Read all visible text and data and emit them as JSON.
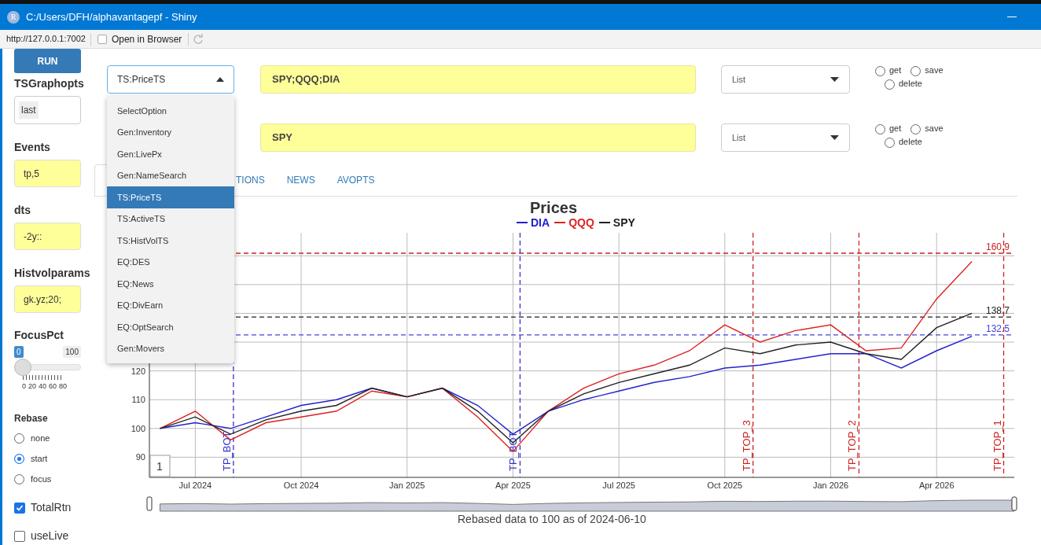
{
  "window": {
    "title": "C:/Users/DFH/alphavantagepf - Shiny",
    "app_icon": "R"
  },
  "address_bar": {
    "url": "http://127.0.0.1:7002",
    "open_in_browser": "Open in Browser"
  },
  "sidebar": {
    "run_button": "RUN",
    "fields": [
      {
        "label": "TSGraphopts",
        "value": "last",
        "kind": "chip"
      },
      {
        "label": "Events",
        "value": "tp,5",
        "kind": "yellow"
      },
      {
        "label": "dts",
        "value": "-2y::",
        "kind": "yellow"
      },
      {
        "label": "Histvolparams",
        "value": "gk.yz;20;",
        "kind": "yellow"
      }
    ],
    "focus": {
      "label": "FocusPct",
      "min_label": "0",
      "max_label": "100",
      "level": 0,
      "tick_labels": [
        "0",
        "20",
        "40",
        "60",
        "80"
      ]
    },
    "rebase": {
      "label": "Rebase",
      "options": [
        {
          "label": "none",
          "selected": false
        },
        {
          "label": "start",
          "selected": true
        },
        {
          "label": "focus",
          "selected": false
        }
      ]
    },
    "checkboxes": [
      {
        "label": "TotalRtn",
        "checked": true
      },
      {
        "label": "useLive",
        "checked": false
      }
    ]
  },
  "function_select": {
    "value": "TS:PriceTS",
    "expanded": true,
    "options": [
      {
        "label": "SelectOption",
        "selected": false
      },
      {
        "label": "Gen:Inventory",
        "selected": false
      },
      {
        "label": "Gen:LivePx",
        "selected": false
      },
      {
        "label": "Gen:NameSearch",
        "selected": false
      },
      {
        "label": "TS:PriceTS",
        "selected": true
      },
      {
        "label": "TS:ActiveTS",
        "selected": false
      },
      {
        "label": "TS:HistVolTS",
        "selected": false
      },
      {
        "label": "EQ:DES",
        "selected": false
      },
      {
        "label": "EQ:News",
        "selected": false
      },
      {
        "label": "EQ:DivEarn",
        "selected": false
      },
      {
        "label": "EQ:OptSearch",
        "selected": false
      },
      {
        "label": "Gen:Movers",
        "selected": false
      }
    ]
  },
  "ticker_rows": [
    {
      "value": "SPY;QQQ;DIA",
      "list": "List",
      "actions": [
        {
          "label": "get",
          "selected": false
        },
        {
          "label": "save",
          "selected": false
        },
        {
          "label": "delete",
          "selected": false
        }
      ]
    },
    {
      "value": "SPY",
      "list": "List",
      "actions": [
        {
          "label": "get",
          "selected": false
        },
        {
          "label": "save",
          "selected": false
        },
        {
          "label": "delete",
          "selected": false
        }
      ]
    }
  ],
  "tabs": [
    {
      "label": "TIONS",
      "selected": false
    },
    {
      "label": "NEWS",
      "selected": false
    },
    {
      "label": "AVOPTS",
      "selected": false
    }
  ],
  "chart": {
    "plot_badge": "1",
    "caption": "Rebased data to 100 as of 2024-06-10",
    "chart_data": {
      "type": "line",
      "title": "Prices",
      "categories": [
        null,
        "Jul 2024",
        null,
        null,
        "Oct 2024",
        null,
        null,
        "Jan 2025",
        null,
        null,
        "Apr 2025",
        null,
        null,
        "Jul 2025",
        null,
        null,
        "Oct 2025",
        null,
        null,
        "Jan 2026",
        null,
        null,
        "Apr 2026",
        null
      ],
      "series": [
        {
          "name": "DIA",
          "color": "#2222cc",
          "values": [
            100,
            102,
            100,
            104,
            108,
            110,
            114,
            111,
            114,
            108,
            98,
            106,
            110,
            113,
            116,
            118,
            121,
            122,
            124,
            126,
            126,
            121,
            127,
            132
          ]
        },
        {
          "name": "QQQ",
          "color": "#dd2222",
          "values": [
            100,
            106,
            96,
            102,
            104,
            106,
            113,
            111,
            114,
            104,
            92,
            106,
            114,
            119,
            122,
            127,
            136,
            130,
            134,
            136,
            127,
            128,
            145,
            158
          ]
        },
        {
          "name": "SPY",
          "color": "#222222",
          "values": [
            100,
            104,
            98,
            103,
            106,
            108,
            114,
            111,
            114,
            106,
            95,
            106,
            112,
            116,
            119,
            122,
            128,
            126,
            129,
            130,
            126,
            124,
            135,
            140
          ]
        }
      ],
      "ylim": [
        83,
        168
      ],
      "yticks": [
        90,
        100,
        110,
        120
      ],
      "grid": true,
      "ref_lines": [
        {
          "axis": "y",
          "value": 160.9,
          "label": "160.9",
          "color": "#cc2222"
        },
        {
          "axis": "y",
          "value": 138.7,
          "label": "138.7",
          "color": "#222222"
        },
        {
          "axis": "y",
          "value": 132.5,
          "label": "132.5",
          "color": "#4444dd"
        }
      ]
    },
    "events": [
      {
        "label": "TP_BOT",
        "kind": "bottom"
      },
      {
        "label": "TP_BOT",
        "kind": "bottom"
      },
      {
        "label": "TP_TOP_3",
        "kind": "top"
      },
      {
        "label": "TP_TOP_2",
        "kind": "top"
      },
      {
        "label": "TP_TOP_1",
        "kind": "top"
      }
    ]
  }
}
